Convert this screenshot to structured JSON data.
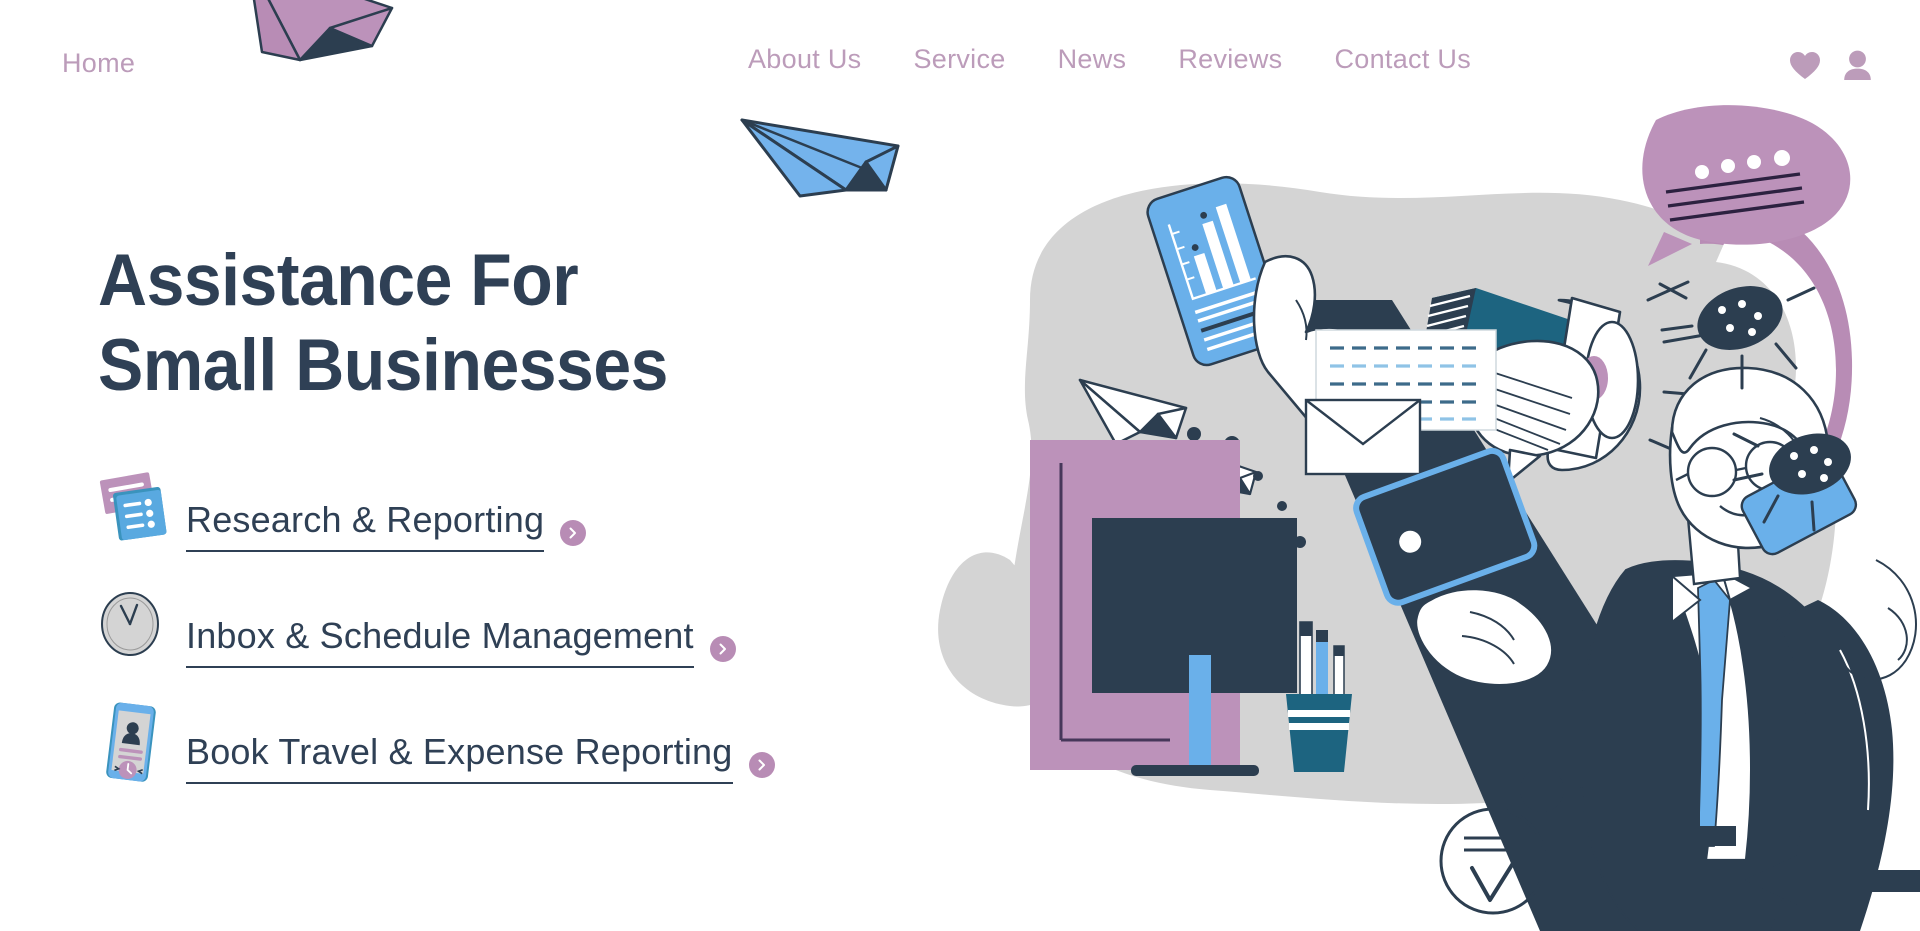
{
  "nav": {
    "home_label": "Home",
    "links": [
      {
        "label": "About Us"
      },
      {
        "label": "Service"
      },
      {
        "label": "News"
      },
      {
        "label": "Reviews"
      },
      {
        "label": "Contact Us"
      }
    ],
    "icons": [
      {
        "name": "heart-icon"
      },
      {
        "name": "user-icon"
      }
    ]
  },
  "hero": {
    "headline_line1": "Assistance For",
    "headline_line2": "Small Businesses",
    "features": [
      {
        "label": "Research & Reporting",
        "icon": "cards-list-icon",
        "chevron": "›"
      },
      {
        "label": "Inbox & Schedule Management",
        "icon": "clock-icon",
        "chevron": "›"
      },
      {
        "label": "Book Travel & Expense Reporting",
        "icon": "smartphone-profile-icon",
        "chevron": "›"
      }
    ]
  },
  "colors": {
    "accent_purple": "#b88cb5",
    "nav_link": "#bc9cba",
    "headline_navy": "#2f4055",
    "blob_gray": "#d4d4d4",
    "blue": "#6ab0ea",
    "teal": "#1d6480",
    "background": "#ffffff"
  },
  "illustration": {
    "elements": [
      {
        "name": "paper-plane-purple"
      },
      {
        "name": "paper-plane-blue"
      },
      {
        "name": "paper-plane-white-large"
      },
      {
        "name": "paper-plane-white-small"
      },
      {
        "name": "gray-blob-backdrop"
      },
      {
        "name": "monitor"
      },
      {
        "name": "purple-panel"
      },
      {
        "name": "pen-cup"
      },
      {
        "name": "phone-with-chart"
      },
      {
        "name": "megaphone"
      },
      {
        "name": "speech-bubble-purple"
      },
      {
        "name": "speech-bubble-white"
      },
      {
        "name": "document-dashed-lines"
      },
      {
        "name": "envelope"
      },
      {
        "name": "tablet"
      },
      {
        "name": "businessman-on-phone"
      },
      {
        "name": "virus-dot-1"
      },
      {
        "name": "virus-dot-2"
      },
      {
        "name": "circle-check-icon"
      },
      {
        "name": "arrow-left-1"
      },
      {
        "name": "arrow-left-2"
      }
    ]
  }
}
